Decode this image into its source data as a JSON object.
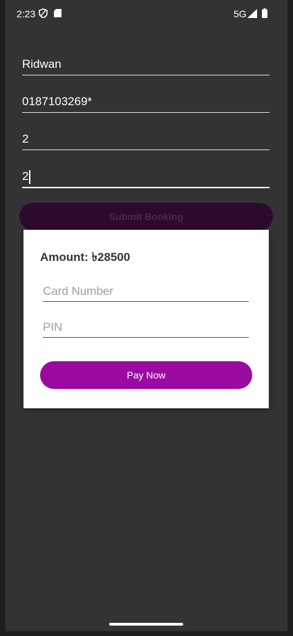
{
  "status_bar": {
    "time": "2:23",
    "network": "5G",
    "icons": [
      "shield-icon",
      "sd-card-icon",
      "signal-icon",
      "battery-icon"
    ]
  },
  "form": {
    "name_value": "Ridwan",
    "phone_value": "0187103269*",
    "field3_value": "2",
    "field4_value": "2",
    "submit_label": "Submit Booking"
  },
  "dialog": {
    "amount_label": "Amount: ৳28500",
    "card_placeholder": "Card Number",
    "pin_placeholder": "PIN",
    "pay_label": "Pay Now"
  },
  "colors": {
    "background": "#333333",
    "pay_button": "#9a0aa0",
    "submit_button_dimmed": "#2c0a2d"
  }
}
